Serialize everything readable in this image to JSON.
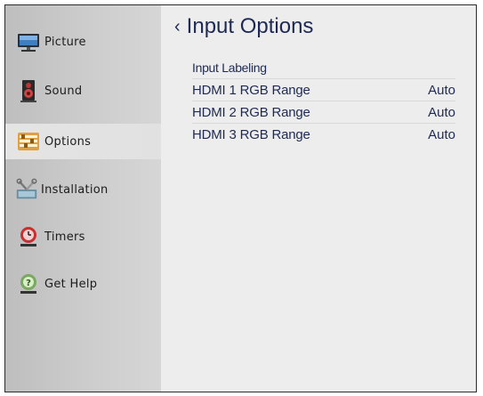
{
  "sidebar": {
    "items": [
      {
        "label": "Picture",
        "icon": "picture-icon"
      },
      {
        "label": "Sound",
        "icon": "speaker-icon"
      },
      {
        "label": "Options",
        "icon": "options-icon"
      },
      {
        "label": "Installation",
        "icon": "tools-icon"
      },
      {
        "label": "Timers",
        "icon": "timer-icon"
      },
      {
        "label": "Get Help",
        "icon": "help-icon"
      }
    ],
    "selected": "Options"
  },
  "main": {
    "title": "Input Options",
    "back_icon": "back-chevron-icon",
    "rows": [
      {
        "label": "Input Labeling",
        "value": ""
      },
      {
        "label": "HDMI 1 RGB Range",
        "value": "Auto"
      },
      {
        "label": "HDMI 2 RGB Range",
        "value": "Auto"
      },
      {
        "label": "HDMI 3 RGB Range",
        "value": "Auto"
      }
    ]
  },
  "colors": {
    "text_primary": "#1e2a55",
    "sidebar_bg": "#c6c6c6",
    "main_bg": "#ededed"
  }
}
